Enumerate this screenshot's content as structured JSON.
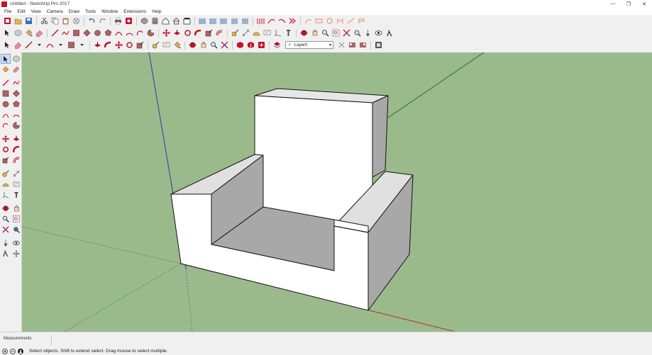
{
  "window": {
    "title": "Untitled - SketchUp Pro 2017",
    "minimize": "—",
    "maximize": "❐",
    "close": "✕"
  },
  "menu": [
    "File",
    "Edit",
    "View",
    "Camera",
    "Draw",
    "Tools",
    "Window",
    "Extensions",
    "Help"
  ],
  "layer_selector": {
    "value": "Layer0",
    "check": "✓"
  },
  "measurements": {
    "label": "Measurements"
  },
  "status": {
    "hint": "Select objects. Shift to extend select. Drag mouse to select multiple."
  },
  "colors": {
    "viewport": "#9aba8c",
    "accent_red": "#c8102e",
    "face_front": "#ffffff",
    "face_dark": "#a8a8a8"
  }
}
